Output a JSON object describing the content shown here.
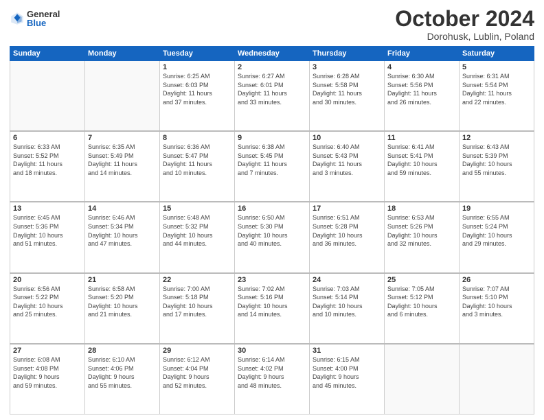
{
  "logo": {
    "general": "General",
    "blue": "Blue"
  },
  "header": {
    "month": "October 2024",
    "location": "Dorohusk, Lublin, Poland"
  },
  "weekdays": [
    "Sunday",
    "Monday",
    "Tuesday",
    "Wednesday",
    "Thursday",
    "Friday",
    "Saturday"
  ],
  "weeks": [
    [
      {
        "day": "",
        "detail": ""
      },
      {
        "day": "",
        "detail": ""
      },
      {
        "day": "1",
        "detail": "Sunrise: 6:25 AM\nSunset: 6:03 PM\nDaylight: 11 hours\nand 37 minutes."
      },
      {
        "day": "2",
        "detail": "Sunrise: 6:27 AM\nSunset: 6:01 PM\nDaylight: 11 hours\nand 33 minutes."
      },
      {
        "day": "3",
        "detail": "Sunrise: 6:28 AM\nSunset: 5:58 PM\nDaylight: 11 hours\nand 30 minutes."
      },
      {
        "day": "4",
        "detail": "Sunrise: 6:30 AM\nSunset: 5:56 PM\nDaylight: 11 hours\nand 26 minutes."
      },
      {
        "day": "5",
        "detail": "Sunrise: 6:31 AM\nSunset: 5:54 PM\nDaylight: 11 hours\nand 22 minutes."
      }
    ],
    [
      {
        "day": "6",
        "detail": "Sunrise: 6:33 AM\nSunset: 5:52 PM\nDaylight: 11 hours\nand 18 minutes."
      },
      {
        "day": "7",
        "detail": "Sunrise: 6:35 AM\nSunset: 5:49 PM\nDaylight: 11 hours\nand 14 minutes."
      },
      {
        "day": "8",
        "detail": "Sunrise: 6:36 AM\nSunset: 5:47 PM\nDaylight: 11 hours\nand 10 minutes."
      },
      {
        "day": "9",
        "detail": "Sunrise: 6:38 AM\nSunset: 5:45 PM\nDaylight: 11 hours\nand 7 minutes."
      },
      {
        "day": "10",
        "detail": "Sunrise: 6:40 AM\nSunset: 5:43 PM\nDaylight: 11 hours\nand 3 minutes."
      },
      {
        "day": "11",
        "detail": "Sunrise: 6:41 AM\nSunset: 5:41 PM\nDaylight: 10 hours\nand 59 minutes."
      },
      {
        "day": "12",
        "detail": "Sunrise: 6:43 AM\nSunset: 5:39 PM\nDaylight: 10 hours\nand 55 minutes."
      }
    ],
    [
      {
        "day": "13",
        "detail": "Sunrise: 6:45 AM\nSunset: 5:36 PM\nDaylight: 10 hours\nand 51 minutes."
      },
      {
        "day": "14",
        "detail": "Sunrise: 6:46 AM\nSunset: 5:34 PM\nDaylight: 10 hours\nand 47 minutes."
      },
      {
        "day": "15",
        "detail": "Sunrise: 6:48 AM\nSunset: 5:32 PM\nDaylight: 10 hours\nand 44 minutes."
      },
      {
        "day": "16",
        "detail": "Sunrise: 6:50 AM\nSunset: 5:30 PM\nDaylight: 10 hours\nand 40 minutes."
      },
      {
        "day": "17",
        "detail": "Sunrise: 6:51 AM\nSunset: 5:28 PM\nDaylight: 10 hours\nand 36 minutes."
      },
      {
        "day": "18",
        "detail": "Sunrise: 6:53 AM\nSunset: 5:26 PM\nDaylight: 10 hours\nand 32 minutes."
      },
      {
        "day": "19",
        "detail": "Sunrise: 6:55 AM\nSunset: 5:24 PM\nDaylight: 10 hours\nand 29 minutes."
      }
    ],
    [
      {
        "day": "20",
        "detail": "Sunrise: 6:56 AM\nSunset: 5:22 PM\nDaylight: 10 hours\nand 25 minutes."
      },
      {
        "day": "21",
        "detail": "Sunrise: 6:58 AM\nSunset: 5:20 PM\nDaylight: 10 hours\nand 21 minutes."
      },
      {
        "day": "22",
        "detail": "Sunrise: 7:00 AM\nSunset: 5:18 PM\nDaylight: 10 hours\nand 17 minutes."
      },
      {
        "day": "23",
        "detail": "Sunrise: 7:02 AM\nSunset: 5:16 PM\nDaylight: 10 hours\nand 14 minutes."
      },
      {
        "day": "24",
        "detail": "Sunrise: 7:03 AM\nSunset: 5:14 PM\nDaylight: 10 hours\nand 10 minutes."
      },
      {
        "day": "25",
        "detail": "Sunrise: 7:05 AM\nSunset: 5:12 PM\nDaylight: 10 hours\nand 6 minutes."
      },
      {
        "day": "26",
        "detail": "Sunrise: 7:07 AM\nSunset: 5:10 PM\nDaylight: 10 hours\nand 3 minutes."
      }
    ],
    [
      {
        "day": "27",
        "detail": "Sunrise: 6:08 AM\nSunset: 4:08 PM\nDaylight: 9 hours\nand 59 minutes."
      },
      {
        "day": "28",
        "detail": "Sunrise: 6:10 AM\nSunset: 4:06 PM\nDaylight: 9 hours\nand 55 minutes."
      },
      {
        "day": "29",
        "detail": "Sunrise: 6:12 AM\nSunset: 4:04 PM\nDaylight: 9 hours\nand 52 minutes."
      },
      {
        "day": "30",
        "detail": "Sunrise: 6:14 AM\nSunset: 4:02 PM\nDaylight: 9 hours\nand 48 minutes."
      },
      {
        "day": "31",
        "detail": "Sunrise: 6:15 AM\nSunset: 4:00 PM\nDaylight: 9 hours\nand 45 minutes."
      },
      {
        "day": "",
        "detail": ""
      },
      {
        "day": "",
        "detail": ""
      }
    ]
  ]
}
